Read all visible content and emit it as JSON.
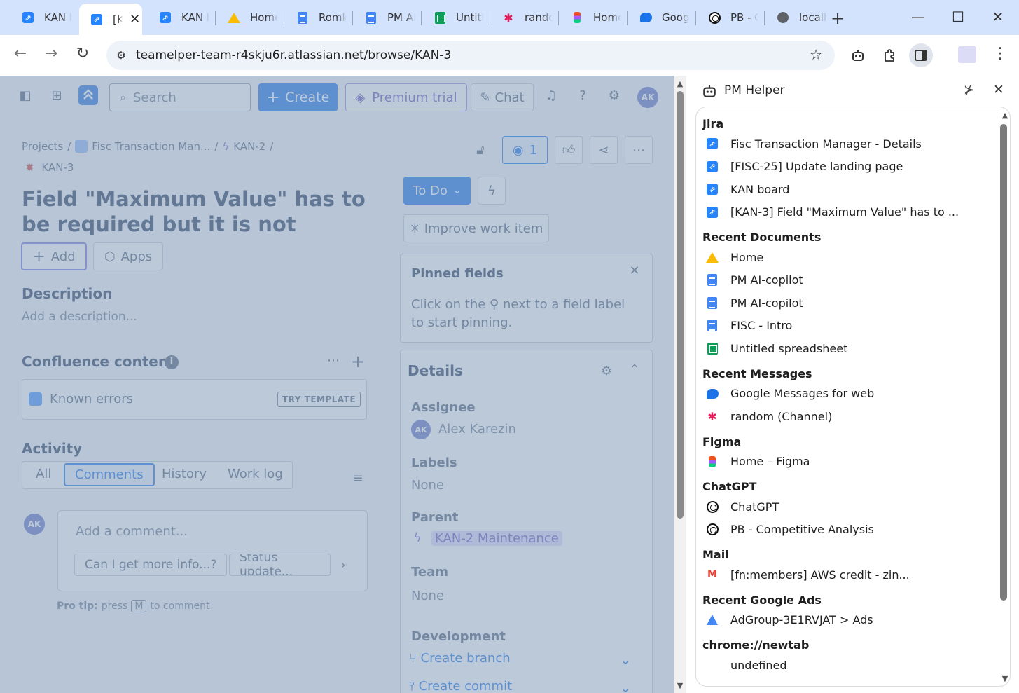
{
  "browser": {
    "tabs": [
      {
        "label": "KAN b",
        "icon": "jira-icon"
      },
      {
        "label": "[K",
        "icon": "jira-icon",
        "active": true
      },
      {
        "label": "KAN b",
        "icon": "jira-icon"
      },
      {
        "label": "Home",
        "icon": "google-drive-icon"
      },
      {
        "label": "Romk",
        "icon": "google-docs-icon"
      },
      {
        "label": "PM AI",
        "icon": "google-docs-icon"
      },
      {
        "label": "Untitl",
        "icon": "google-sheets-icon"
      },
      {
        "label": "rando",
        "icon": "slack-icon"
      },
      {
        "label": "Home",
        "icon": "figma-icon"
      },
      {
        "label": "Goog",
        "icon": "google-messages-icon"
      },
      {
        "label": "PB - C",
        "icon": "chatgpt-icon"
      },
      {
        "label": "localh",
        "icon": "globe-icon"
      }
    ],
    "url": "teamelper-team-r4skju6r.atlassian.net/browse/KAN-3"
  },
  "jira": {
    "search_placeholder": "Search",
    "create_label": "Create",
    "premium_label": "Premium trial",
    "chat_label": "Chat",
    "avatar_initials": "AK",
    "breadcrumbs": {
      "projects": "Projects",
      "project": "Fisc Transaction Man...",
      "parent": "KAN-2",
      "issue": "KAN-3"
    },
    "watch_count": "1",
    "issue_title": "Field \"Maximum Value\" has to be required but it is not",
    "add_label": "Add",
    "apps_label": "Apps",
    "status_label": "To Do",
    "improve_label": "Improve work item",
    "description_heading": "Description",
    "description_placeholder": "Add a description...",
    "confluence_heading": "Confluence content",
    "confluence_item": "Known errors",
    "try_template": "TRY TEMPLATE",
    "activity_heading": "Activity",
    "activity_tabs": [
      "All",
      "Comments",
      "History",
      "Work log"
    ],
    "comment_placeholder": "Add a comment...",
    "chips": [
      "Can I get more info...?",
      "Status update..."
    ],
    "pro_tip_bold": "Pro tip:",
    "pro_tip_press": "press",
    "pro_tip_key": "M",
    "pro_tip_rest": "to comment",
    "pinned": {
      "title": "Pinned fields",
      "text_before": "Click on the",
      "text_after": "next to a field label",
      "text_line2": "to start pinning."
    },
    "details": {
      "title": "Details",
      "assignee_label": "Assignee",
      "assignee": "Alex Karezin",
      "labels_label": "Labels",
      "labels_value": "None",
      "parent_label": "Parent",
      "parent_value": "KAN-2 Maintenance",
      "team_label": "Team",
      "team_value": "None",
      "development_label": "Development",
      "create_branch": "Create branch",
      "create_commit": "Create commit"
    }
  },
  "side_panel": {
    "title": "PM Helper",
    "groups": [
      {
        "title": "Jira",
        "items": [
          {
            "label": "Fisc Transaction Manager - Details",
            "icon": "jira-icon"
          },
          {
            "label": "[FISC-25] Update landing page",
            "icon": "jira-icon"
          },
          {
            "label": "KAN board",
            "icon": "jira-icon"
          },
          {
            "label": "[KAN-3] Field \"Maximum Value\" has to ...",
            "icon": "jira-icon"
          }
        ]
      },
      {
        "title": "Recent Documents",
        "items": [
          {
            "label": "Home",
            "icon": "google-drive-icon"
          },
          {
            "label": "PM AI-copilot",
            "icon": "google-docs-icon"
          },
          {
            "label": "PM AI-copilot",
            "icon": "google-docs-icon"
          },
          {
            "label": "FISC - Intro",
            "icon": "google-docs-icon"
          },
          {
            "label": "Untitled spreadsheet",
            "icon": "google-sheets-icon"
          }
        ]
      },
      {
        "title": "Recent Messages",
        "items": [
          {
            "label": "Google Messages for web",
            "icon": "google-messages-icon"
          },
          {
            "label": "random (Channel)",
            "icon": "slack-icon"
          }
        ]
      },
      {
        "title": "Figma",
        "items": [
          {
            "label": "Home – Figma",
            "icon": "figma-icon"
          }
        ]
      },
      {
        "title": "ChatGPT",
        "items": [
          {
            "label": "ChatGPT",
            "icon": "chatgpt-icon"
          },
          {
            "label": "PB - Competitive Analysis",
            "icon": "chatgpt-icon"
          }
        ]
      },
      {
        "title": "Mail",
        "items": [
          {
            "label": "[fn:members] AWS credit - zin...",
            "icon": "gmail-icon"
          }
        ]
      },
      {
        "title": "Recent Google Ads",
        "items": [
          {
            "label": "AdGroup-3E1RVJAT > Ads",
            "icon": "google-ads-icon"
          }
        ]
      },
      {
        "title": "chrome://newtab",
        "items": [
          {
            "label": "undefined",
            "icon": "none"
          }
        ]
      }
    ]
  }
}
